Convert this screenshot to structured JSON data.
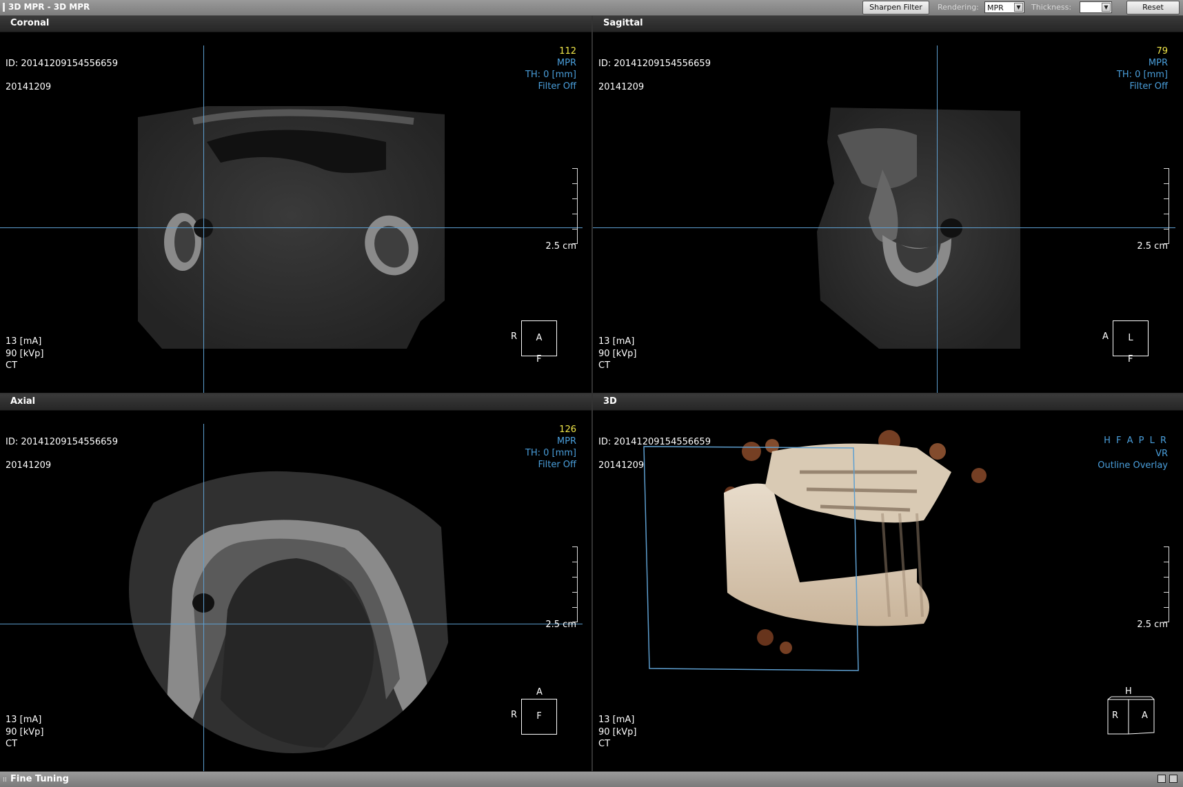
{
  "toolbar": {
    "title": "3D MPR - 3D MPR",
    "sharpen_label": "Sharpen Filter",
    "rendering_label": "Rendering:",
    "rendering_value": "MPR",
    "thickness_label": "Thickness:",
    "thickness_value": "",
    "reset_label": "Reset"
  },
  "viewports": {
    "coronal": {
      "title": "Coronal",
      "slice": "112",
      "id": "ID: 20141209154556659",
      "date": "20141209",
      "mode": "MPR",
      "thickness": "TH: 0 [mm]",
      "filter": "Filter Off",
      "scale": "2.5 cm",
      "ma": "13 [mA]",
      "kvp": "90 [kVp]",
      "modality": "CT",
      "orient_center": "A",
      "orient_left": "R",
      "orient_bottom": "F"
    },
    "sagittal": {
      "title": "Sagittal",
      "slice": "79",
      "id": "ID: 20141209154556659",
      "date": "20141209",
      "mode": "MPR",
      "thickness": "TH: 0 [mm]",
      "filter": "Filter Off",
      "scale": "2.5 cm",
      "ma": "13 [mA]",
      "kvp": "90 [kVp]",
      "modality": "CT",
      "orient_center": "L",
      "orient_left": "A",
      "orient_bottom": "F"
    },
    "axial": {
      "title": "Axial",
      "slice": "126",
      "id": "ID: 20141209154556659",
      "date": "20141209",
      "mode": "MPR",
      "thickness": "TH: 0 [mm]",
      "filter": "Filter Off",
      "scale": "2.5 cm",
      "ma": "13 [mA]",
      "kvp": "90 [kVp]",
      "modality": "CT",
      "orient_center": "F",
      "orient_left": "R",
      "orient_top": "A"
    },
    "threeD": {
      "title": "3D",
      "id": "ID: 20141209154556659",
      "date": "20141209",
      "view_buttons": "H F A P L R",
      "mode": "VR",
      "overlay": "Outline Overlay",
      "scale": "2.5 cm",
      "ma": "13 [mA]",
      "kvp": "90 [kVp]",
      "modality": "CT",
      "cube_top": "H",
      "cube_left": "R",
      "cube_right": "A"
    }
  },
  "bottombar": {
    "title": "Fine Tuning"
  },
  "colors": {
    "crosshair": "#5e9fd0",
    "overlay_blue": "#4a9fdc",
    "slice_yellow": "#f2e84a"
  }
}
